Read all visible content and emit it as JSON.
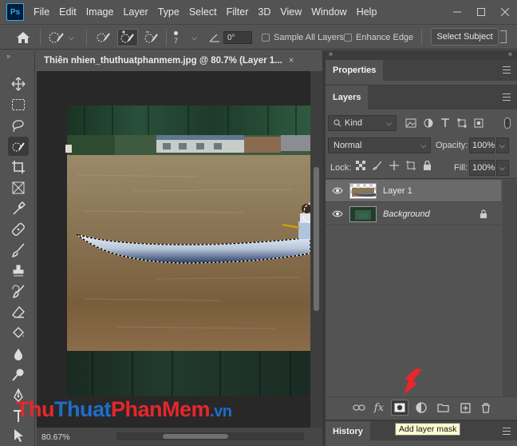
{
  "app": {
    "logo_text": "Ps"
  },
  "menu": [
    "File",
    "Edit",
    "Image",
    "Layer",
    "Type",
    "Select",
    "Filter",
    "3D",
    "View",
    "Window",
    "Help"
  ],
  "options": {
    "brush_size": "7",
    "angle_value": "0°",
    "sample_all_layers": "Sample All Layers",
    "enhance_edge": "Enhance Edge",
    "select_subject": "Select Subject"
  },
  "document": {
    "tab_title": "Thiên nhien_thuthuatphanmem.jpg @ 80.7% (Layer 1...",
    "tab_close": "×",
    "zoom": "80.67%"
  },
  "panels": {
    "properties_tab": "Properties",
    "layers_tab": "Layers",
    "history_tab": "History"
  },
  "layers": {
    "filter_kind": "Kind",
    "blend_mode": "Normal",
    "opacity_label": "Opacity:",
    "opacity_value": "100%",
    "lock_label": "Lock:",
    "fill_label": "Fill:",
    "fill_value": "100%",
    "items": [
      {
        "name": "Layer 1",
        "selected": true
      },
      {
        "name": "Background",
        "locked": true
      }
    ]
  },
  "tooltip": "Add layer mask",
  "watermark": {
    "part1": "Thu",
    "part2": "Thuat",
    "part3": "PhanMem",
    "part4": ".vn"
  },
  "icons": [
    "home-icon",
    "quick-selection-icon",
    "move-icon",
    "marquee-icon",
    "lasso-icon",
    "crop-icon",
    "frame-icon",
    "eyedropper-icon",
    "healing-icon",
    "brush-icon",
    "stamp-icon",
    "history-brush-icon",
    "eraser-icon",
    "paint-bucket-icon",
    "blur-icon",
    "dodge-icon",
    "pen-icon",
    "eye-icon",
    "lock-icon",
    "link-icon",
    "fx-icon",
    "mask-icon",
    "adjustment-icon",
    "folder-icon",
    "new-layer-icon",
    "trash-icon"
  ],
  "colors": {
    "accent": "#31a8ff",
    "arrow": "#e8262b",
    "wm_red": "#e8262b",
    "wm_blue": "#1e6ec8",
    "tooltip_bg": "#fbfbd0"
  }
}
